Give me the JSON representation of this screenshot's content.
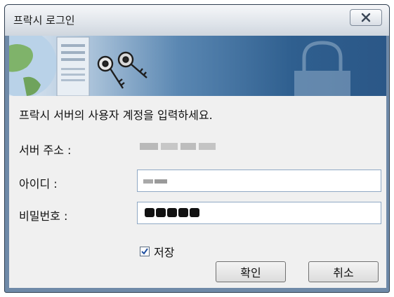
{
  "window": {
    "title": "프락시 로그인"
  },
  "prompt": "프락시 서버의 사용자 계정을 입력하세요.",
  "form": {
    "server_label": "서버 주소 :",
    "id_label": "아이디 :",
    "password_label": "비밀번호 :",
    "save_label": "저장",
    "save_checked": true
  },
  "buttons": {
    "ok": "확인",
    "cancel": "취소"
  },
  "icons": {
    "close": "close-icon",
    "keys": "keys-icon",
    "globe": "globe-icon",
    "lock": "padlock-icon",
    "check": "checkmark-icon"
  }
}
